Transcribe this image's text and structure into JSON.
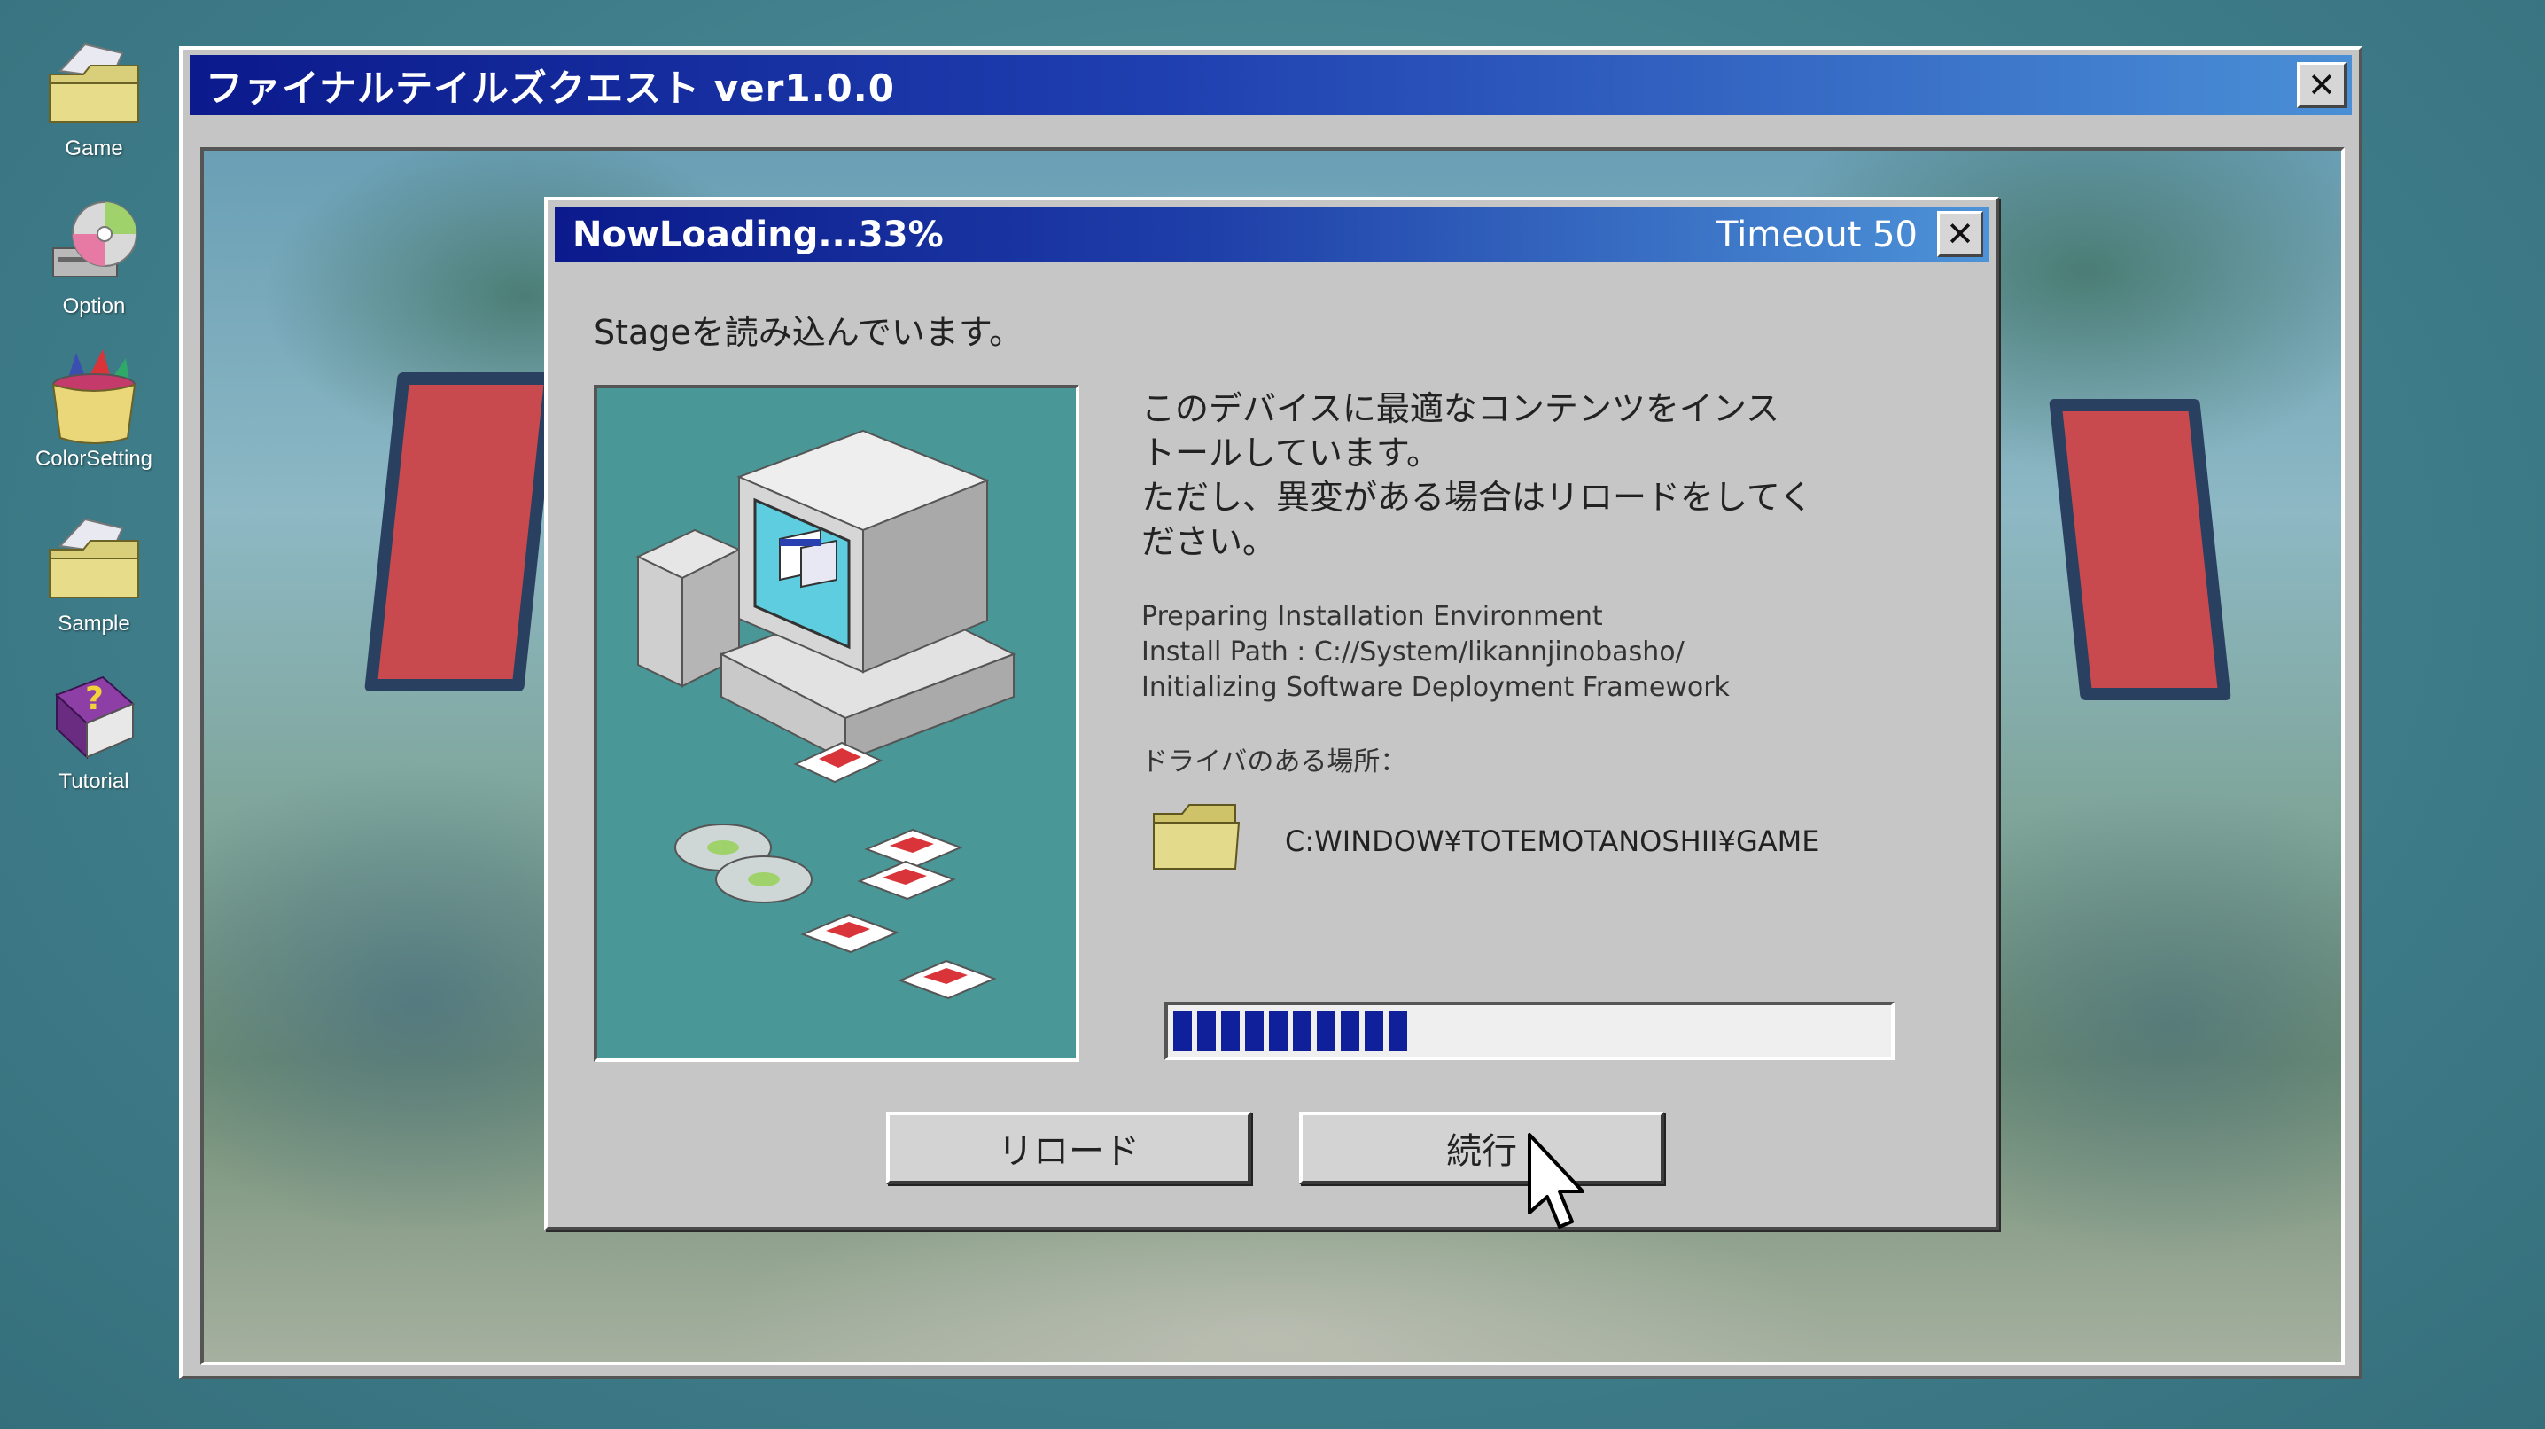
{
  "desktop": {
    "icons": [
      {
        "label": "Game",
        "icon": "folder-icon"
      },
      {
        "label": "Option",
        "icon": "cd-drive-icon"
      },
      {
        "label": "ColorSetting",
        "icon": "paint-bucket-icon"
      },
      {
        "label": "Sample",
        "icon": "folder-icon"
      },
      {
        "label": "Tutorial",
        "icon": "help-book-icon"
      }
    ]
  },
  "main_window": {
    "title": "ファイナルテイルズクエスト  ver1.0.0",
    "close_glyph": "✕"
  },
  "dialog": {
    "title": "NowLoading...33%",
    "timeout": "Timeout 50",
    "close_glyph": "✕",
    "heading": "Stageを読み込んでいます。",
    "message_jp": [
      "このデバイスに最適なコンテンツをインス",
      "トールしています。",
      "ただし、異変がある場合はリロードをしてく",
      "ださい。"
    ],
    "message_en": [
      "Preparing Installation Environment",
      "Install Path  : C://System/likannjinobasho/",
      "Initializing Software Deployment Framework"
    ],
    "driver_label": "ドライバのある場所：",
    "driver_path": "C:WINDOW¥TOTEMOTANOSHII¥GAME",
    "progress_fraction": 0.33,
    "buttons": {
      "reload": "リロード",
      "continue": "続行"
    }
  },
  "colors": {
    "title_bar_start": "#0b1a8c",
    "title_bar_end": "#4d93d8",
    "window_face": "#c6c6c6",
    "progress_fill": "#101f9a",
    "desktop": "#4a8592"
  }
}
